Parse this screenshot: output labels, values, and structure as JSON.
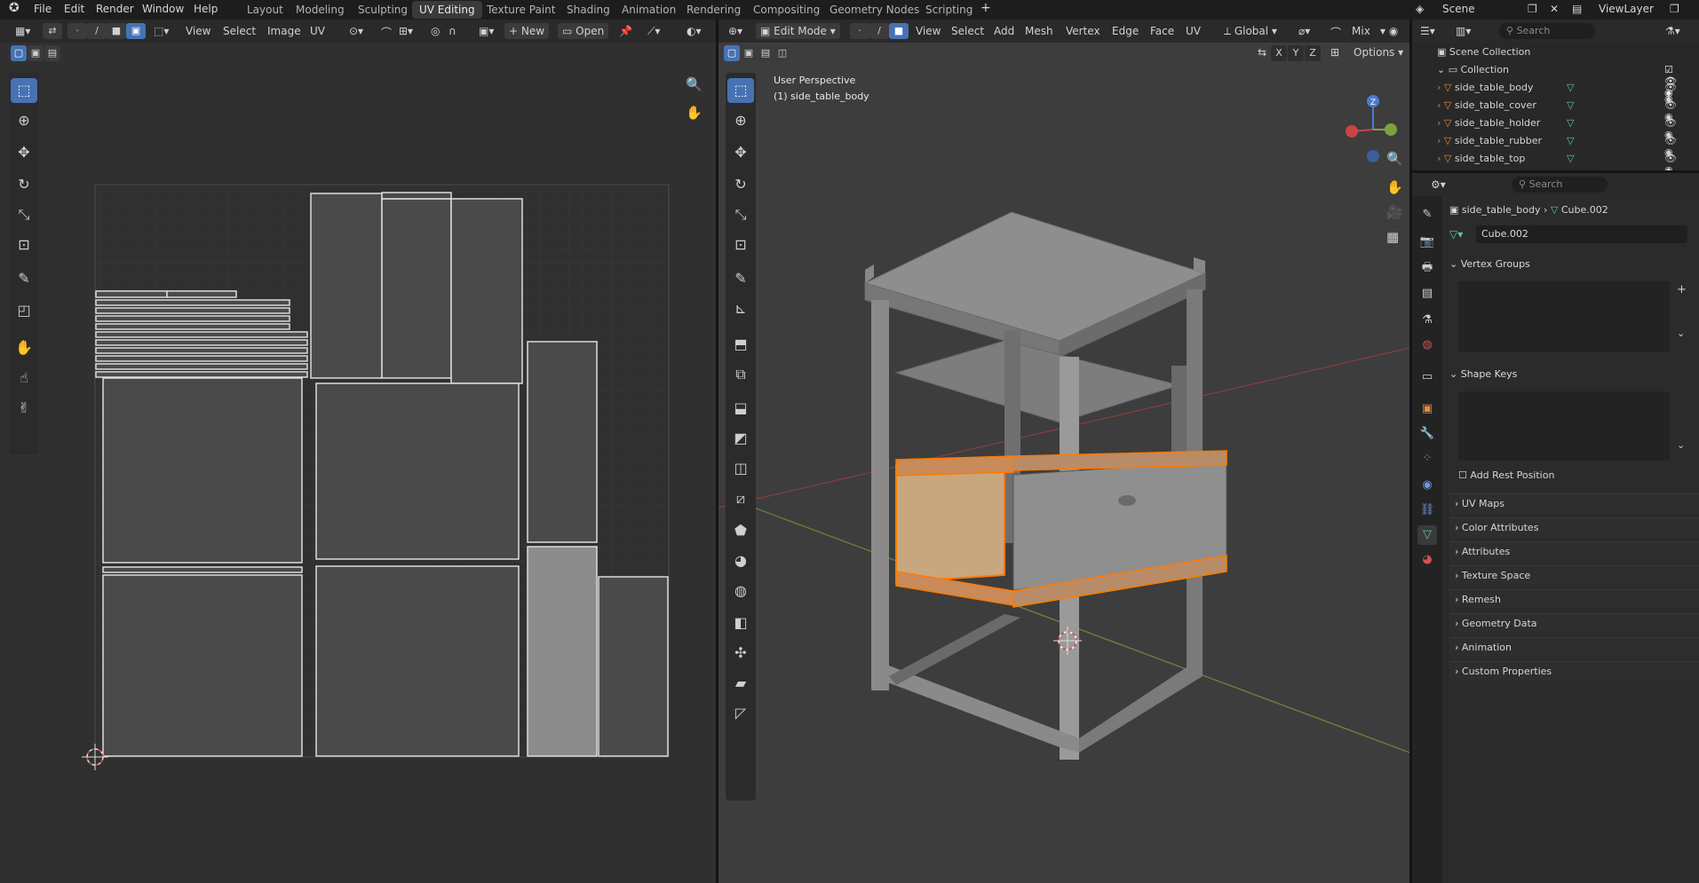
{
  "topmenu": {
    "file": "File",
    "edit": "Edit",
    "render": "Render",
    "window": "Window",
    "help": "Help"
  },
  "workspaces": [
    "Layout",
    "Modeling",
    "Sculpting",
    "UV Editing",
    "Texture Paint",
    "Shading",
    "Animation",
    "Rendering",
    "Compositing",
    "Geometry Nodes",
    "Scripting"
  ],
  "workspace_active": "UV Editing",
  "scene": {
    "label": "Scene",
    "viewlayer": "ViewLayer"
  },
  "uv_editor": {
    "menus": [
      "View",
      "Select",
      "Image",
      "UV"
    ],
    "new": "New",
    "open": "Open"
  },
  "viewport": {
    "mode": "Edit Mode",
    "menus": [
      "View",
      "Select",
      "Add",
      "Mesh",
      "Vertex",
      "Edge",
      "Face",
      "UV"
    ],
    "orientation": "Global",
    "shading_mode": "Mix",
    "axes": [
      "X",
      "Y",
      "Z"
    ],
    "options": "Options",
    "overlay_title": "User Perspective",
    "overlay_object": "(1) side_table_body",
    "gizmo_z": "Z"
  },
  "outliner": {
    "search_placeholder": "Search",
    "root": "Scene Collection",
    "collection": "Collection",
    "objects": [
      "side_table_body",
      "side_table_cover",
      "side_table_holder",
      "side_table_rubber",
      "side_table_top"
    ]
  },
  "properties": {
    "search_placeholder": "Search",
    "breadcrumb_obj": "side_table_body",
    "breadcrumb_mesh": "Cube.002",
    "mesh_name": "Cube.002",
    "vertex_groups": "Vertex Groups",
    "shape_keys": "Shape Keys",
    "add_rest_position": "Add Rest Position",
    "panels": [
      "UV Maps",
      "Color Attributes",
      "Attributes",
      "Texture Space",
      "Remesh",
      "Geometry Data",
      "Animation",
      "Custom Properties"
    ]
  },
  "colors": {
    "accent": "#4772b3",
    "selection": "#ff7a00",
    "uv_fill": "#4a4a4a",
    "uv_selected": "#8c8c8c"
  }
}
